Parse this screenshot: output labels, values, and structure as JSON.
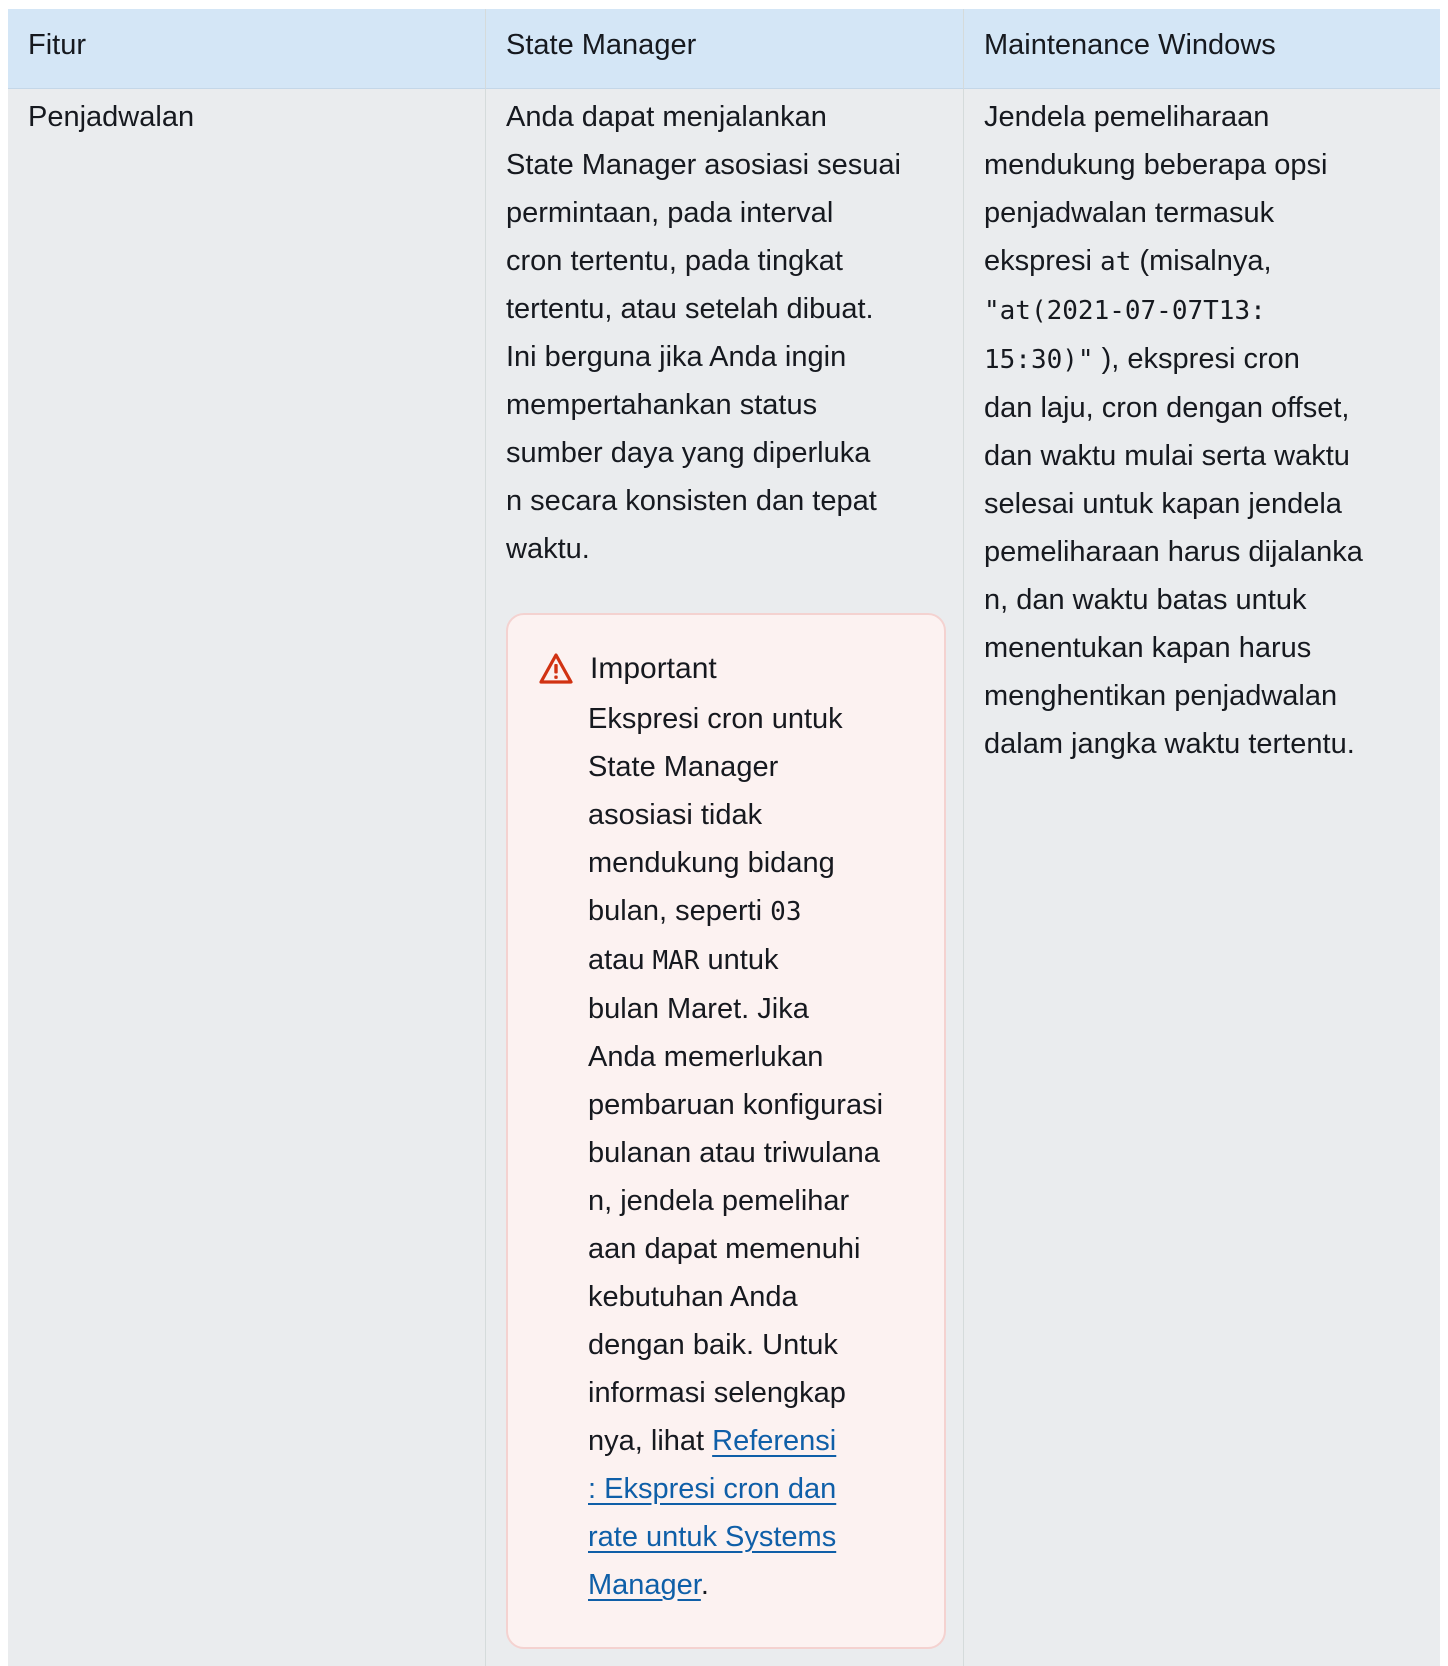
{
  "table": {
    "headers": [
      "Fitur",
      "State Manager",
      "Maintenance Windows"
    ],
    "row": {
      "feature": "Penjadwalan",
      "state_manager_text": [
        "Anda dapat menjalankan",
        "State Manager asosiasi sesuai",
        "permintaan, pada interval",
        "cron tertentu, pada tingkat",
        "tertentu, atau setelah dibuat.",
        "Ini berguna jika Anda ingin",
        "mempertahankan status",
        "sumber daya yang diperluka",
        "n secara konsisten dan tepat",
        "waktu."
      ],
      "important": {
        "title": "Important",
        "lines": [
          "Ekspresi cron untuk",
          "State Manager",
          "asosiasi tidak",
          "mendukung bidang"
        ],
        "line_bulan_pre": "bulan, seperti ",
        "code_03": "03",
        "line_atau_pre": "atau ",
        "code_mar": "MAR",
        "line_atau_post": " untuk",
        "lines2": [
          "bulan Maret. Jika",
          "Anda memerlukan",
          "pembaruan konfigurasi",
          "bulanan atau triwulana",
          "n, jendela pemelihar",
          "aan dapat memenuhi",
          "kebutuhan Anda",
          "dengan baik. Untuk",
          "informasi selengkap"
        ],
        "link_pre": "nya, lihat ",
        "link_lines": [
          "Referensi",
          ": Ekspresi cron dan",
          "rate untuk Systems",
          "Manager"
        ],
        "link_post": "."
      },
      "maintenance_text": {
        "l1": "Jendela pemeliharaan",
        "l2": "mendukung beberapa opsi",
        "l3": "penjadwalan termasuk",
        "l4_pre": "ekspresi ",
        "l4_code": "at",
        "l4_post": " (misalnya,",
        "code_line1": "\"at(2021-07-07T13:",
        "code_line2": "15:30)\"",
        "l6_post": " ), ekspresi cron",
        "rest": [
          "dan laju, cron dengan offset,",
          "dan waktu mulai serta waktu",
          "selesai untuk kapan jendela",
          "pemeliharaan harus dijalanka",
          "n, dan waktu batas untuk",
          "menentukan kapan harus",
          "menghentikan penjadwalan",
          "dalam jangka waktu tertentu."
        ]
      }
    }
  },
  "colors": {
    "header_bg": "#d4e6f6",
    "body_bg": "#eaecee",
    "important_bg": "#fcf2f1",
    "important_border": "#f4d2d0",
    "warning_red": "#d13212",
    "link": "#0f5fa8"
  },
  "icons": {
    "important": "warning-triangle-icon"
  }
}
